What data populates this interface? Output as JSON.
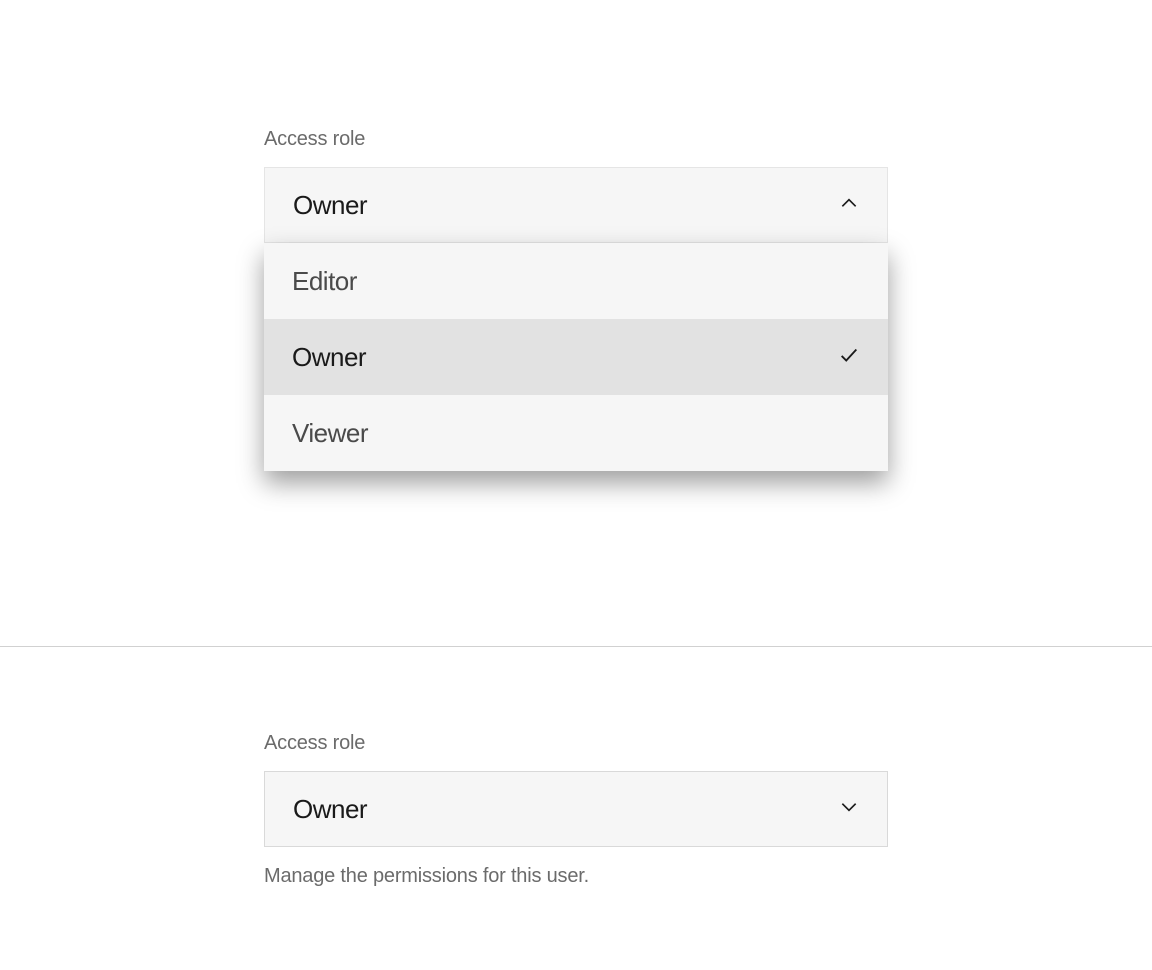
{
  "top": {
    "label": "Access role",
    "selected": "Owner",
    "options": [
      "Editor",
      "Owner",
      "Viewer"
    ],
    "selected_index": 1
  },
  "bottom": {
    "label": "Access role",
    "selected": "Owner",
    "helper": "Manage the permissions for this user."
  }
}
